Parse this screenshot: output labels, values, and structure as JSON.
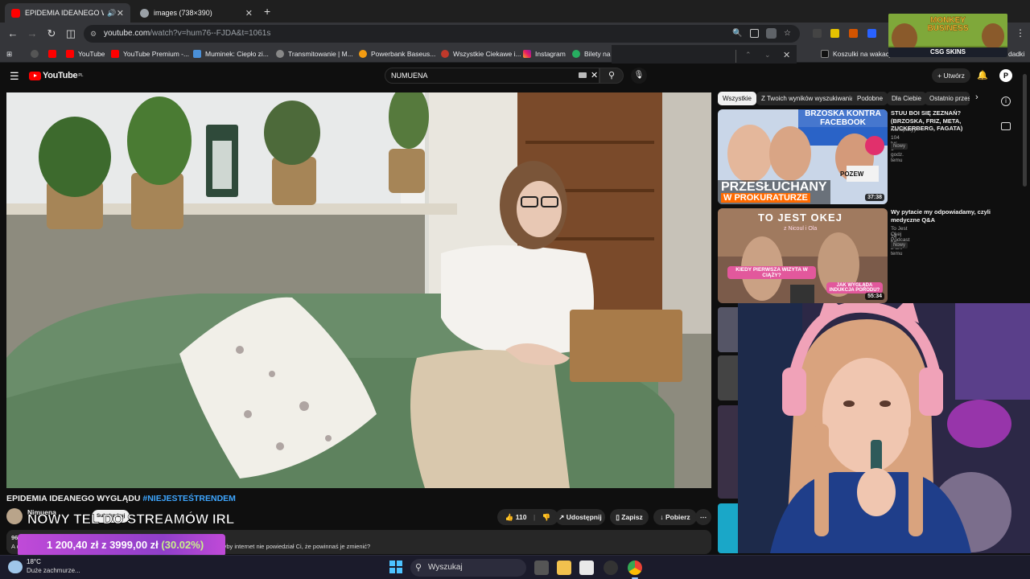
{
  "browser": {
    "tabs": [
      {
        "title": "EPIDEMIA IDEANEGO WYG...",
        "active": true
      },
      {
        "title": "images (738×390)",
        "active": false
      }
    ],
    "url_host": "youtube.com",
    "url_path": "/watch?v=hum76--FJDA&t=1061s",
    "bookmarks": [
      "YouTube",
      "YouTube Premium -...",
      "Muminek: Ciepło zi...",
      "Transmitowanie | M...",
      "Powerbank Baseus...",
      "Wszystkie Ciekawe i...",
      "Instagram",
      "Bilety na l",
      "Koszulki na wakacje...",
      "dadki"
    ]
  },
  "youtube": {
    "logo": "YouTube",
    "logo_region": "PL",
    "search_value": "NUMUENA",
    "create_label": "Utwórz",
    "chips": [
      "Wszystkie",
      "Z Twoich wyników wyszukiwania",
      "Podobne",
      "Dla Ciebie",
      "Ostatnio przes"
    ],
    "video": {
      "title_main": "EPIDEMIA IDEANEGO WYGLĄDU",
      "title_tag": "#NIEJESTEŚTRENDEM",
      "channel": "Nimuena",
      "subscribe_label": "Subskrybuj",
      "likes": "110",
      "share_label": "Udostępnij",
      "save_label": "Zapisz",
      "download_label": "Pobierz",
      "desc_views": "964",
      "desc_time": "temu",
      "desc_text": "A c",
      "desc_text_end": "Ci, gdyby internet nie powiedział Ci, że powinnaś je zmienić?"
    },
    "recommendations": [
      {
        "title": "STUU BOI SIĘ ZEZNAŃ? (BRZOSKA, FRIZ, META, ZUCKERBERG, FAGATA)",
        "channel": "Konopskyy",
        "meta": "104 tys. · 1 godz. temu",
        "badge": "Nowy",
        "duration": "37:38",
        "thumb_text_top": "BRZOSKA KONTRA FACEBOOK",
        "thumb_text_mid": "PRZESŁUCHANY",
        "thumb_text_bot": "W PROKURATURZE",
        "thumb_text_tag": "POZEW"
      },
      {
        "title": "Wy pytacie my odpowiadamy, czyli medyczne Q&A",
        "channel": "To Jest Okej Podcast",
        "meta": "14 tys. · 2 dni temu",
        "badge": "Nowy",
        "duration": "55:34",
        "thumb_text_top": "TO JEST OKEJ",
        "thumb_text_sub": "z Nicoul i Ola",
        "thumb_text_q1": "KIEDY PIERWSZA WIZYTA W CIĄŻY?",
        "thumb_text_q2": "JAK WYGLĄDA INDUKCJA PORODU?"
      }
    ]
  },
  "stream_overlay": {
    "title": "NOWY TEL DO STREAMÓW IRL",
    "price_current": "1 200,40 zł",
    "price_of": "z 3999,00 zł",
    "price_pct": "(30.02%)",
    "ad_title": "MONKEY BUSINESS",
    "ad_sub": "CSG SKINS"
  },
  "taskbar": {
    "weather_temp": "18°C",
    "weather_desc": "Duże zachmurze...",
    "search_placeholder": "Wyszukaj"
  },
  "colors": {
    "yt_red": "#ff0000",
    "link_blue": "#3ea6ff",
    "price_bar": "#b347d4",
    "price_pct": "#c8f08a"
  }
}
